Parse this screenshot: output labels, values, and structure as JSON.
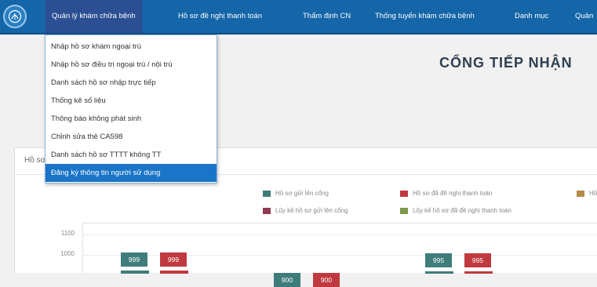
{
  "navbar": {
    "items": [
      {
        "label": "Quản lý khám chữa bệnh",
        "active": true
      },
      {
        "label": "Hồ sơ đề nghị thanh toán"
      },
      {
        "label": "Thẩm định CN"
      },
      {
        "label": "Thống tuyến khám chữa bệnh"
      },
      {
        "label": "Danh mục"
      },
      {
        "label": "Quản"
      }
    ]
  },
  "dropdown": {
    "items": [
      {
        "label": "Nhập hồ sơ khám ngoại trú"
      },
      {
        "label": "Nhập hồ sơ điều trị ngoại trú / nội trú"
      },
      {
        "label": "Danh sách hồ sơ nhập trực tiếp"
      },
      {
        "label": "Thống kê số liệu"
      },
      {
        "label": "Thông báo không phát sinh"
      },
      {
        "label": "Chỉnh sửa thẻ CA598"
      },
      {
        "label": "Danh sách hồ sơ TTTT không TT"
      },
      {
        "label": "Đăng ký thông tin người sử dụng",
        "selected": true
      }
    ]
  },
  "page": {
    "title": "CỔNG TIẾP NHẬN",
    "panel_title": "Hồ sơ"
  },
  "colors": {
    "navbar": "#1566a8",
    "active_nav": "#2b4f92",
    "selected_item": "#1a75c8"
  },
  "chart_data": {
    "type": "bar",
    "legend": [
      {
        "label": "Hồ sơ gửi lên cổng",
        "color": "#3e7d7b"
      },
      {
        "label": "Hồ sơ đã đề nghị thanh toán",
        "color": "#c0393f"
      },
      {
        "label": "Hồ",
        "color": "#b88a4a"
      },
      {
        "label": "Lũy kế hồ sơ gửi lên cổng",
        "color": "#8d3a52"
      },
      {
        "label": "Lũy kế hồ sơ đã đề nghị thanh toán",
        "color": "#7d9a4d"
      }
    ],
    "yticks": [
      "1100",
      "1000"
    ],
    "ylim": [
      0,
      1100
    ],
    "series": [
      {
        "name": "Hồ sơ gửi lên cổng",
        "color": "#3e7d7b",
        "values": [
          999,
          900,
          995
        ]
      },
      {
        "name": "Hồ sơ đã đề nghị thanh toán",
        "color": "#c0393f",
        "values": [
          999,
          900,
          995
        ]
      }
    ],
    "data_labels": [
      "999",
      "999",
      "900",
      "900",
      "995",
      "995"
    ]
  }
}
